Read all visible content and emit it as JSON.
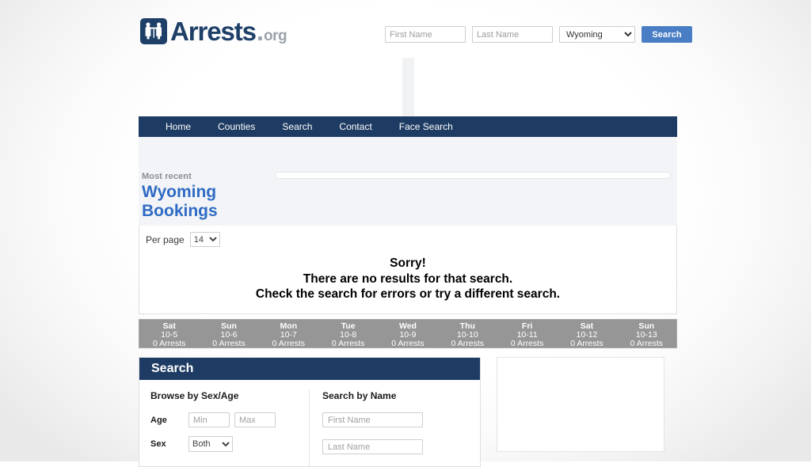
{
  "brand": {
    "name": "Arrests",
    "dot": ".",
    "tld": "org",
    "logo_icon": "scales-of-justice-icon"
  },
  "header_search": {
    "first_name_placeholder": "First Name",
    "first_name_value": "",
    "last_name_placeholder": "Last Name",
    "last_name_value": "",
    "state_selected": "Wyoming",
    "state_options": [
      "Wyoming"
    ],
    "search_button_label": "Search"
  },
  "nav": {
    "items": [
      {
        "label": "Home"
      },
      {
        "label": "Counties"
      },
      {
        "label": "Search"
      },
      {
        "label": "Contact"
      },
      {
        "label": "Face Search"
      }
    ]
  },
  "masthead": {
    "kicker": "Most recent",
    "heading": "Wyoming Bookings"
  },
  "results": {
    "per_page_label": "Per page",
    "per_page_selected": "14",
    "per_page_options": [
      "14"
    ],
    "message_line1": "Sorry!",
    "message_line2": "There are no results for that search.",
    "message_line3": "Check the search for errors or try a different search."
  },
  "days": [
    {
      "name": "Sat",
      "date": "10-5",
      "count": "0 Arrests"
    },
    {
      "name": "Sun",
      "date": "10-6",
      "count": "0 Arrests"
    },
    {
      "name": "Mon",
      "date": "10-7",
      "count": "0 Arrests"
    },
    {
      "name": "Tue",
      "date": "10-8",
      "count": "0 Arrests"
    },
    {
      "name": "Wed",
      "date": "10-9",
      "count": "0 Arrests"
    },
    {
      "name": "Thu",
      "date": "10-10",
      "count": "0 Arrests"
    },
    {
      "name": "Fri",
      "date": "10-11",
      "count": "0 Arrests"
    },
    {
      "name": "Sat",
      "date": "10-12",
      "count": "0 Arrests"
    },
    {
      "name": "Sun",
      "date": "10-13",
      "count": "0 Arrests"
    }
  ],
  "search_panel": {
    "title": "Search",
    "browse_heading": "Browse by Sex/Age",
    "age_label": "Age",
    "age_min_placeholder": "Min",
    "age_min_value": "",
    "age_max_placeholder": "Max",
    "age_max_value": "",
    "sex_label": "Sex",
    "sex_selected": "Both",
    "sex_options": [
      "Both"
    ],
    "name_heading": "Search by Name",
    "first_name_placeholder": "First Name",
    "first_name_value": "",
    "last_name_placeholder": "Last Name",
    "last_name_value": ""
  },
  "colors": {
    "navy": "#1e3c63",
    "accent_blue": "#2f6bc4",
    "button_blue": "#4a7ec4",
    "day_strip_gray": "#969696",
    "panel_bg": "#f2f4f7"
  }
}
